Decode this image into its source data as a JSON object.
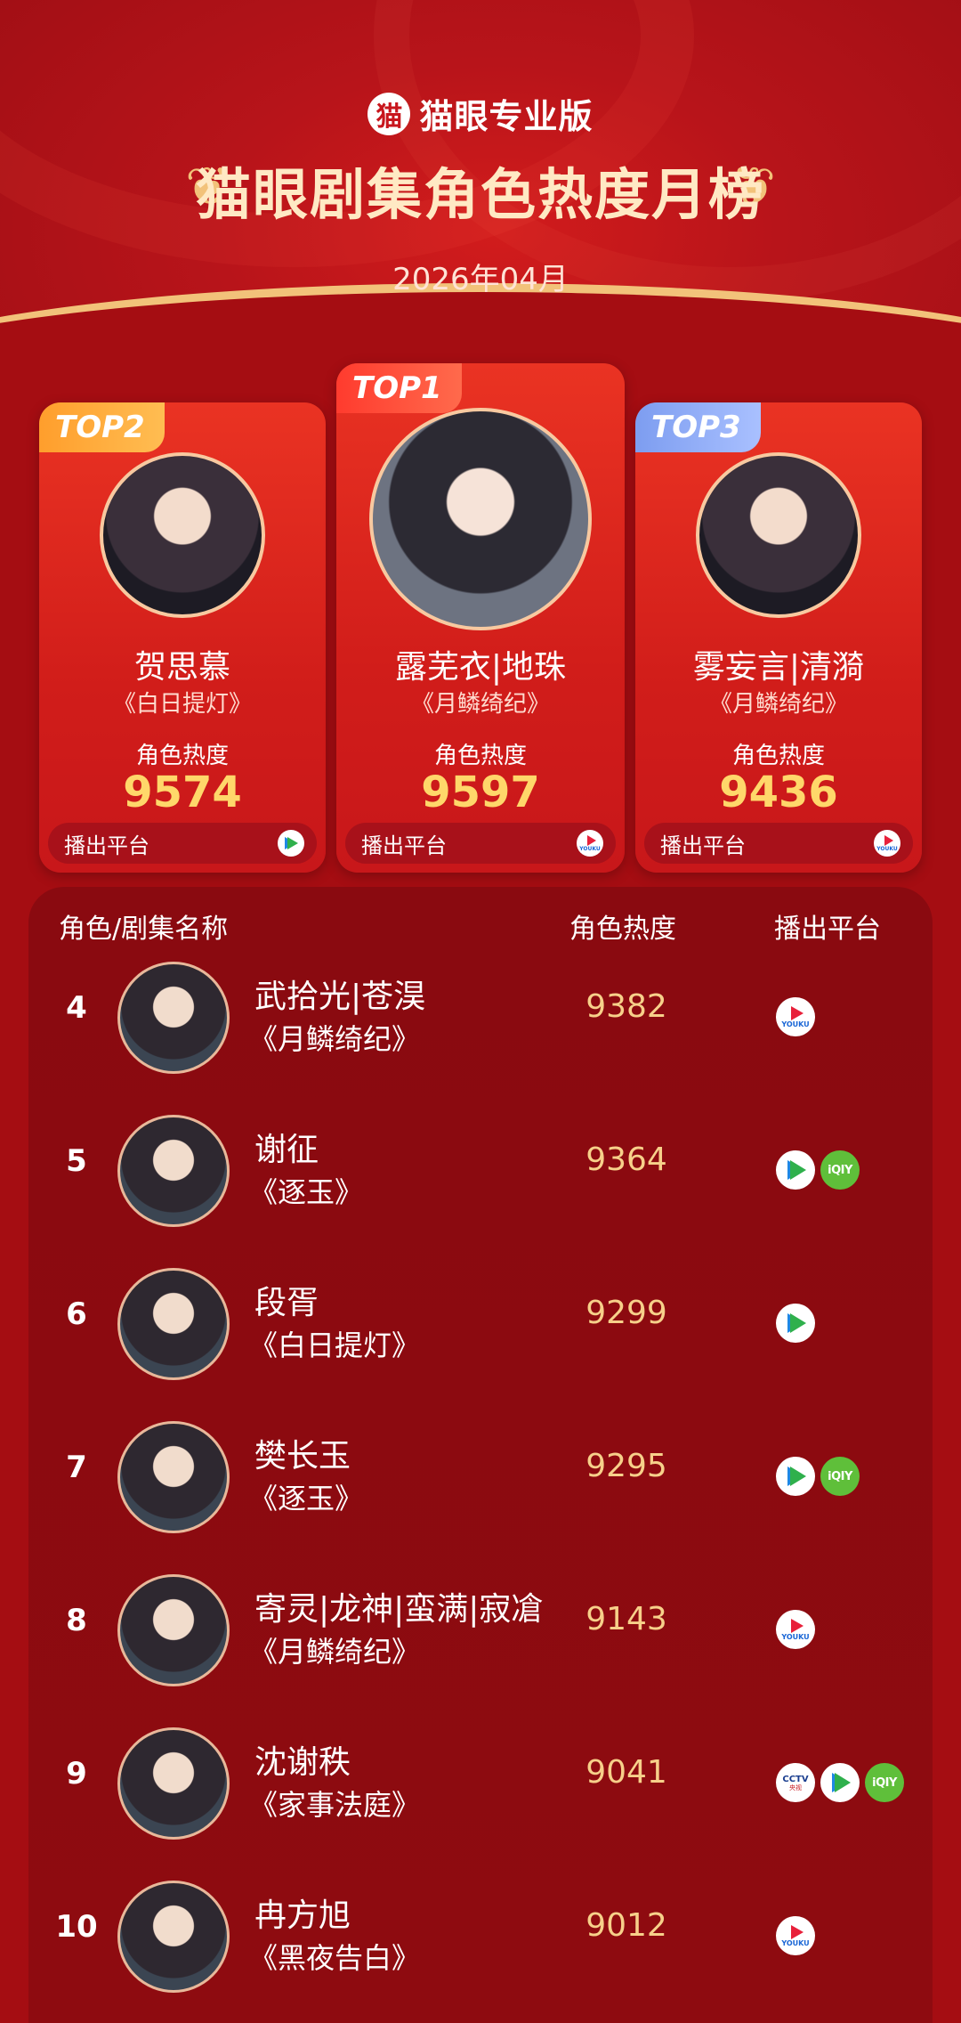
{
  "brand": {
    "logo_glyph": "猫",
    "name": "猫眼专业版"
  },
  "title": "猫眼剧集角色热度月榜",
  "period": "2026年04月",
  "card_common": {
    "heat_label": "角色热度",
    "platform_label": "播出平台"
  },
  "top3": [
    {
      "rank_label": "TOP2",
      "role": "贺思慕",
      "drama": "《白日提灯》",
      "heat": "9574",
      "platforms": [
        "tencent"
      ]
    },
    {
      "rank_label": "TOP1",
      "role": "露芜衣|地珠",
      "drama": "《月鳞绮纪》",
      "heat": "9597",
      "platforms": [
        "youku"
      ]
    },
    {
      "rank_label": "TOP3",
      "role": "雾妄言|清漪",
      "drama": "《月鳞绮纪》",
      "heat": "9436",
      "platforms": [
        "youku"
      ]
    }
  ],
  "list_header": {
    "name": "角色/剧集名称",
    "heat": "角色热度",
    "platform": "播出平台"
  },
  "rows": [
    {
      "rank": "4",
      "role": "武拾光|苍淏",
      "drama": "《月鳞绮纪》",
      "heat": "9382",
      "platforms": [
        "youku"
      ]
    },
    {
      "rank": "5",
      "role": "谢征",
      "drama": "《逐玉》",
      "heat": "9364",
      "platforms": [
        "tencent",
        "iqiyi"
      ]
    },
    {
      "rank": "6",
      "role": "段胥",
      "drama": "《白日提灯》",
      "heat": "9299",
      "platforms": [
        "tencent"
      ]
    },
    {
      "rank": "7",
      "role": "樊长玉",
      "drama": "《逐玉》",
      "heat": "9295",
      "platforms": [
        "tencent",
        "iqiyi"
      ]
    },
    {
      "rank": "8",
      "role": "寄灵|龙神|蛮满|寂凔",
      "drama": "《月鳞绮纪》",
      "heat": "9143",
      "platforms": [
        "youku"
      ]
    },
    {
      "rank": "9",
      "role": "沈谢秩",
      "drama": "《家事法庭》",
      "heat": "9041",
      "platforms": [
        "cctv",
        "tencent",
        "iqiyi"
      ]
    },
    {
      "rank": "10",
      "role": "冉方旭",
      "drama": "《黑夜告白》",
      "heat": "9012",
      "platforms": [
        "youku"
      ]
    }
  ],
  "platform_icons": {
    "youku": {
      "icon": "youku-icon",
      "text": "YOUKU"
    },
    "tencent": {
      "icon": "tencent-video-icon"
    },
    "iqiyi": {
      "icon": "iqiyi-icon",
      "text": "iQIY"
    },
    "cctv": {
      "icon": "cctv-icon",
      "text": "CCTV",
      "sub": "央视"
    }
  },
  "colors": {
    "background": "#a50d12",
    "heat_gold": "#ffd76a",
    "title_gold": "#ffe9c4",
    "accent_line": "#f2c27a"
  }
}
